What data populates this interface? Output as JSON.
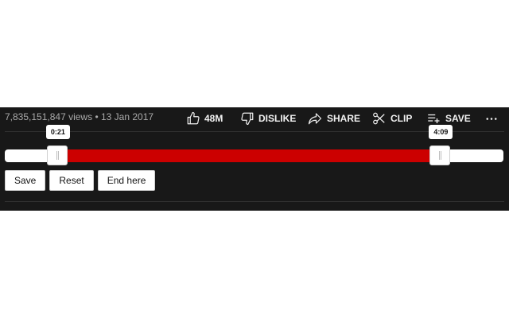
{
  "video": {
    "views": "7,835,151,847 views",
    "separator": "•",
    "date": "13 Jan 2017"
  },
  "actions": {
    "like": {
      "label": "48M",
      "icon": "thumbs-up-icon"
    },
    "dislike": {
      "label": "DISLIKE",
      "icon": "thumbs-down-icon"
    },
    "share": {
      "label": "SHARE",
      "icon": "share-arrow-icon"
    },
    "clip": {
      "label": "CLIP",
      "icon": "scissors-icon"
    },
    "save": {
      "label": "SAVE",
      "icon": "playlist-add-icon"
    },
    "more": {
      "icon": "more-horizontal-icon"
    }
  },
  "range_slider": {
    "start_time": "0:21",
    "end_time": "4:09",
    "start_fraction": 0.105,
    "end_fraction": 0.873,
    "fill_color": "#cc0000",
    "track_color": "#ffffff"
  },
  "buttons": {
    "save": "Save",
    "reset": "Reset",
    "end_here": "End here"
  }
}
